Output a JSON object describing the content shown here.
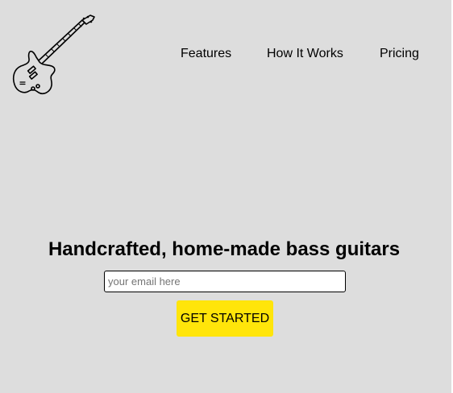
{
  "header": {
    "logo_icon": "bass-guitar-icon",
    "nav": {
      "features": "Features",
      "how_it_works": "How It Works",
      "pricing": "Pricing"
    }
  },
  "hero": {
    "title": "Handcrafted, home-made bass guitars",
    "email_placeholder": "your email here",
    "email_value": "",
    "cta_label": "GET STARTED",
    "cta_color": "#ffe50a"
  },
  "colors": {
    "background": "#dddddd"
  }
}
